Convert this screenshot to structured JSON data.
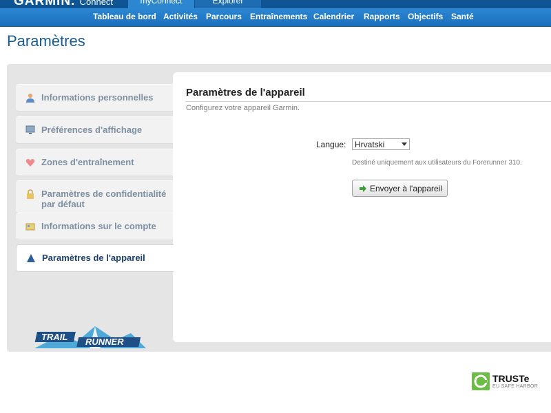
{
  "header": {
    "logo": "GARMIN.",
    "logo_sub": "Connect",
    "tabs": [
      {
        "label": "myConnect"
      },
      {
        "label": "Explorer"
      }
    ]
  },
  "nav": {
    "items": [
      {
        "label": "Tableau de bord"
      },
      {
        "label": "Activités"
      },
      {
        "label": "Parcours"
      },
      {
        "label": "Entraînements"
      },
      {
        "label": "Calendrier"
      },
      {
        "label": "Rapports"
      },
      {
        "label": "Objectifs"
      },
      {
        "label": "Santé"
      }
    ]
  },
  "page": {
    "title": "Paramètres"
  },
  "sidebar": {
    "items": [
      {
        "label": "Informations personnelles",
        "icon": "person-icon"
      },
      {
        "label": "Préférences d'affichage",
        "icon": "monitor-icon"
      },
      {
        "label": "Zones d'entraînement",
        "icon": "heart-icon"
      },
      {
        "label": "Paramètres de confidentialité par défaut",
        "label_line1": "Paramètres de confidentialité",
        "label_line2": "par défaut",
        "icon": "lock-icon"
      },
      {
        "label": "Informations sur le compte",
        "icon": "account-card-icon"
      },
      {
        "label": "Paramètres de l'appareil",
        "icon": "triangle-icon",
        "active": true
      }
    ]
  },
  "device": {
    "title": "Paramètres de l'appareil",
    "subtitle": "Configurez votre appareil Garmin.",
    "language_label": "Langue:",
    "language_value": "Hrvatski",
    "note": "Destiné uniquement aux utilisateurs du Forerunner 310.",
    "send_label": "Envoyer à l'appareil"
  },
  "promo": {
    "line1": "TRAIL",
    "line2": "RUNNER"
  },
  "footer": {
    "truste_name": "TRUSTe",
    "truste_tag": "EU SAFE HARBOR"
  },
  "colors": {
    "nav_bg": "#2a83cf",
    "title_blue": "#1a5c94",
    "active_text": "#1d3f6e",
    "inactive_text": "#7d8fa3",
    "truste_green": "#6cbd45"
  }
}
